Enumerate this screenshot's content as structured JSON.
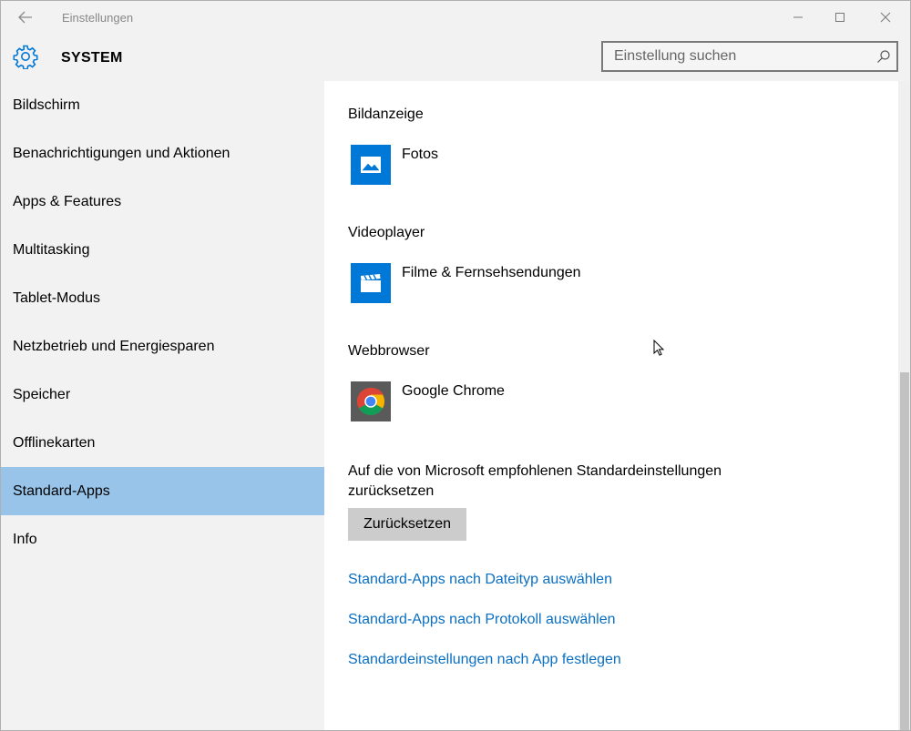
{
  "window": {
    "title": "Einstellungen"
  },
  "header": {
    "section": "SYSTEM",
    "search_placeholder": "Einstellung suchen"
  },
  "sidebar": {
    "items": [
      {
        "label": "Bildschirm"
      },
      {
        "label": "Benachrichtigungen und Aktionen"
      },
      {
        "label": "Apps & Features"
      },
      {
        "label": "Multitasking"
      },
      {
        "label": "Tablet-Modus"
      },
      {
        "label": "Netzbetrieb und Energiesparen"
      },
      {
        "label": "Speicher"
      },
      {
        "label": "Offlinekarten"
      },
      {
        "label": "Standard-Apps"
      },
      {
        "label": "Info"
      }
    ],
    "selected": "Standard-Apps"
  },
  "content": {
    "categories": [
      {
        "label": "Bildanzeige",
        "app": "Fotos",
        "icon": "photos-icon"
      },
      {
        "label": "Videoplayer",
        "app": "Filme & Fernsehsendungen",
        "icon": "movies-tv-icon"
      },
      {
        "label": "Webbrowser",
        "app": "Google Chrome",
        "icon": "chrome-icon"
      }
    ],
    "reset_text": "Auf die von Microsoft empfohlenen Standardeinstellungen zurücksetzen",
    "reset_button": "Zurücksetzen",
    "links": [
      "Standard-Apps nach Dateityp auswählen",
      "Standard-Apps nach Protokoll auswählen",
      "Standardeinstellungen nach App festlegen"
    ]
  },
  "colors": {
    "accent": "#0078d7",
    "selected_nav": "#99c4ea",
    "link": "#0a6fc2"
  }
}
